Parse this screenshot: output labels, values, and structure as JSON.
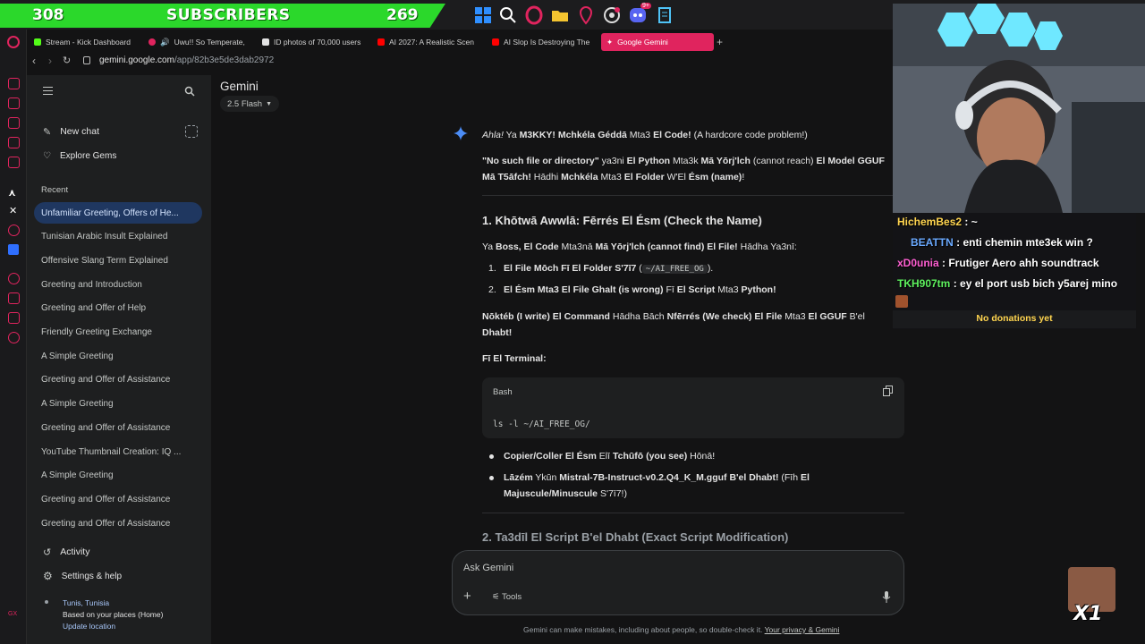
{
  "subscribers": {
    "left_count": "308",
    "label": "SUBSCRIBERS",
    "right_count": "269"
  },
  "taskbar": {
    "icons": [
      "windows-icon",
      "search-icon",
      "opera-icon",
      "folder-icon",
      "pin-icon",
      "obs-icon",
      "discord-icon",
      "notepad-icon"
    ],
    "discord_badge": "9+"
  },
  "tabs": [
    {
      "label": "Stream - Kick Dashboard",
      "favicon_color": "#53fc18"
    },
    {
      "label": "Uwu!! So Temperate,",
      "favicon_color": "#e0245e"
    },
    {
      "label": "ID photos of 70,000 users",
      "favicon_color": "#e3e3e3"
    },
    {
      "label": "AI 2027: A Realistic Scen",
      "favicon_color": "#ff0000"
    },
    {
      "label": "AI Slop Is Destroying The",
      "favicon_color": "#ff0000"
    },
    {
      "label": "Google Gemini",
      "favicon_color": "#ffffff"
    }
  ],
  "address": {
    "domain": "gemini.google.com",
    "path": "/app/82b3e5de3dab2972"
  },
  "sidebar": {
    "new_chat": "New chat",
    "explore_gems": "Explore Gems",
    "recent_label": "Recent",
    "recent": [
      "Unfamiliar Greeting, Offers of He...",
      "Tunisian Arabic Insult Explained",
      "Offensive Slang Term Explained",
      "Greeting and Introduction",
      "Greeting and Offer of Help",
      "Friendly Greeting Exchange",
      "A Simple Greeting",
      "Greeting and Offer of Assistance",
      "A Simple Greeting",
      "Greeting and Offer of Assistance",
      "YouTube Thumbnail Creation: IQ ...",
      "A Simple Greeting",
      "Greeting and Offer of Assistance",
      "Greeting and Offer of Assistance"
    ],
    "activity": "Activity",
    "settings": "Settings & help",
    "location_city": "Tunis, Tunisia",
    "location_basis": "Based on your places (Home)",
    "update_location": "Update location"
  },
  "main": {
    "title": "Gemini",
    "model": "2.5 Flash",
    "response": {
      "intro_italic": "Ahla!",
      "intro_rest": " Ya ",
      "intro_name": "M3KKY!",
      "intro_bold2": " Mchkéla Géddā",
      "intro_mid": " Mta3 ",
      "intro_bold3": "El Code!",
      "intro_end": " (A hardcore code problem!)",
      "p2_bold1": "\"No such file or directory\"",
      "p2_t1": " ya3ni ",
      "p2_bold2": "El Python",
      "p2_t2": " Mta3k ",
      "p2_bold3": "Mā Yōrj'lch",
      "p2_t3": " (cannot reach) ",
      "p2_bold4": "El Model GGUF",
      "p2_line2_bold1": "Mā T5āfch!",
      "p2_line2_t1": " Hādhi ",
      "p2_line2_bold2": "Mchkéla",
      "p2_line2_t2": " Mta3 ",
      "p2_line2_bold3": "El Folder",
      "p2_line2_t3": " W'El ",
      "p2_line2_bold4": "Ésm (name)",
      "p2_line2_end": "!",
      "h1": "1. Khōtwā Awwlā: Fērrés El Ésm (Check the Name)",
      "p3_t1": "Ya ",
      "p3_b1": "Boss, El Code",
      "p3_t2": " Mta3nā ",
      "p3_b2": "Mā Yōrj'lch (cannot find) El File!",
      "p3_t3": " Hādha Ya3nī:",
      "li1_num": "1.",
      "li1_b": "El File Mōch Fī El Folder S'7ī7",
      "li1_open": " (",
      "li1_code": "~/AI_FREE_OG",
      "li1_close": ").",
      "li2_num": "2.",
      "li2_b1": "El Ésm Mta3 El File Ghalt (is wrong)",
      "li2_t": " Fī ",
      "li2_b2": "El Script",
      "li2_t2": " Mta3 ",
      "li2_b3": "Python!",
      "p4_b1": "Nōktéb (I write) El Command",
      "p4_t1": " Hādha Bāch ",
      "p4_b2": "Nfērrés (We check) El File",
      "p4_t2": " Mta3 ",
      "p4_b3": "El GGUF",
      "p4_t3": " B'el",
      "p4_line2_b": "Dhabt!",
      "terminal_label": "Fī El Terminal:",
      "code_lang": "Bash",
      "code_text": "ls -l ~/AI_FREE_OG/",
      "b1_b1": "Copier/Coller El Ésm",
      "b1_t1": " Elī ",
      "b1_b2": "Tchūfō (you see)",
      "b1_t2": " Hōnā!",
      "b2_b1": "Lāzém",
      "b2_t1": " Ykūn ",
      "b2_b2": "Mistral-7B-Instruct-v0.2.Q4_K_M.gguf B'el Dhabt!",
      "b2_t2": " (Fīh ",
      "b2_b3": "El",
      "b2_line2_b": "Majuscule/Minuscule",
      "b2_line2_t": " S'7ī7!)",
      "h2": "2. Ta3dīl El Script B'el Dhabt (Exact Script Modification)"
    },
    "ask_placeholder": "Ask Gemini",
    "tools_label": "Tools",
    "footer_text": "Gemini can make mistakes, including about people, so double-check it. ",
    "footer_link": "Your privacy & Gemini"
  },
  "chat": {
    "messages": [
      {
        "user": "HichemBes2",
        "text": " : ~",
        "color": "#ffd54f"
      },
      {
        "user": "BEATTN",
        "text": " : enti chemin mte3ek win ?",
        "color": "#6aa9ff"
      },
      {
        "user": "xD0unia",
        "text": " : Frutiger Aero ahh soundtrack",
        "color": "#ff5fd2"
      },
      {
        "user": "TKH907tm",
        "text": " : ey el port usb bich y5arej mino",
        "color": "#5ef25e"
      }
    ],
    "no_donations": "No donations yet"
  },
  "emote": {
    "label": "X1"
  }
}
